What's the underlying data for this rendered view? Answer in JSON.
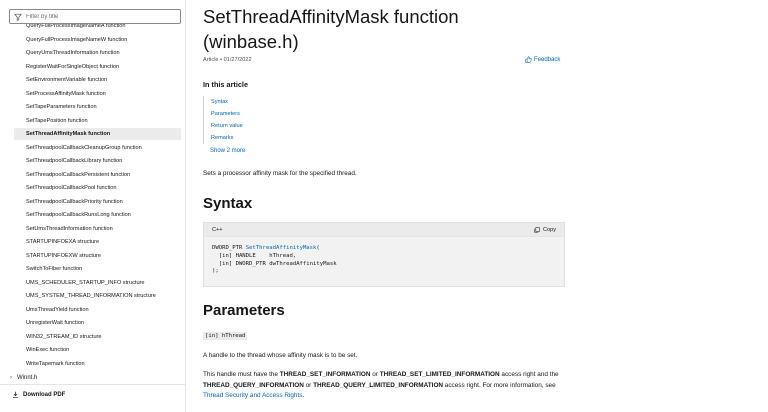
{
  "sidebar": {
    "filter_placeholder": "Filter by title",
    "items": [
      {
        "label": "QueryFullProcessImageNameA function",
        "selected": false
      },
      {
        "label": "QueryFullProcessImageNameW function",
        "selected": false
      },
      {
        "label": "QueryUmsThreadInformation function",
        "selected": false
      },
      {
        "label": "RegisterWaitForSingleObject function",
        "selected": false
      },
      {
        "label": "SetEnvironmentVariable function",
        "selected": false
      },
      {
        "label": "SetProcessAffinityMask function",
        "selected": false
      },
      {
        "label": "SetTapeParameters function",
        "selected": false
      },
      {
        "label": "SetTapePosition function",
        "selected": false
      },
      {
        "label": "SetThreadAffinityMask function",
        "selected": true
      },
      {
        "label": "SetThreadpoolCallbackCleanupGroup function",
        "selected": false
      },
      {
        "label": "SetThreadpoolCallbackLibrary function",
        "selected": false
      },
      {
        "label": "SetThreadpoolCallbackPersistent function",
        "selected": false
      },
      {
        "label": "SetThreadpoolCallbackPool function",
        "selected": false
      },
      {
        "label": "SetThreadpoolCallbackPriority function",
        "selected": false
      },
      {
        "label": "SetThreadpoolCallbackRunsLong function",
        "selected": false
      },
      {
        "label": "SetUmsThreadInformation function",
        "selected": false
      },
      {
        "label": "STARTUPINFOEXA structure",
        "selected": false
      },
      {
        "label": "STARTUPINFOEXW structure",
        "selected": false
      },
      {
        "label": "SwitchToFiber function",
        "selected": false
      },
      {
        "label": "UMS_SCHEDULER_STARTUP_INFO structure",
        "selected": false
      },
      {
        "label": "UMS_SYSTEM_THREAD_INFORMATION structure",
        "selected": false
      },
      {
        "label": "UmsThreadYield function",
        "selected": false
      },
      {
        "label": "UnregisterWait function",
        "selected": false
      },
      {
        "label": "WIN32_STREAM_ID structure",
        "selected": false
      },
      {
        "label": "WinExec function",
        "selected": false
      },
      {
        "label": "WriteTapemark function",
        "selected": false
      }
    ],
    "winnt_label": "Winnt.h",
    "download_label": "Download PDF"
  },
  "article": {
    "title_line1": "SetThreadAffinityMask function",
    "title_line2": "(winbase.h)",
    "meta": "Article • 01/27/2022",
    "feedback": "Feedback",
    "in_this_article": "In this article",
    "links": [
      "Syntax",
      "Parameters",
      "Return value",
      "Remarks"
    ],
    "show_more": "Show 2 more",
    "description": "Sets a processor affinity mask for the specified thread.",
    "syntax_heading": "Syntax",
    "code_lang": "C++",
    "copy_label": "Copy",
    "code_line1_prefix": "DWORD_PTR ",
    "code_line1_fn": "SetThreadAffinityMask",
    "code_line1_suffix": "(",
    "code_line2": "  [in] HANDLE    hThread,",
    "code_line3": "  [in] DWORD_PTR dwThreadAffinityMask",
    "code_line4": ");",
    "parameters_heading": "Parameters",
    "param_name": "[in] hThread",
    "param_desc": "A handle to the thread whose affinity mask is to be set.",
    "p2_a": "This handle must have the ",
    "p2_b": "THREAD_SET_INFORMATION",
    "p2_c": " or ",
    "p2_d": "THREAD_SET_LIMITED_INFORMATION",
    "p2_e": " access right and the ",
    "p2_f": "THREAD_QUERY_INFORMATION",
    "p2_g": " or ",
    "p2_h": "THREAD_QUERY_LIMITED_INFORMATION",
    "p2_i": " access right. For more information, see ",
    "p2_link": "Thread Security and Access Rights",
    "p2_end": "."
  }
}
